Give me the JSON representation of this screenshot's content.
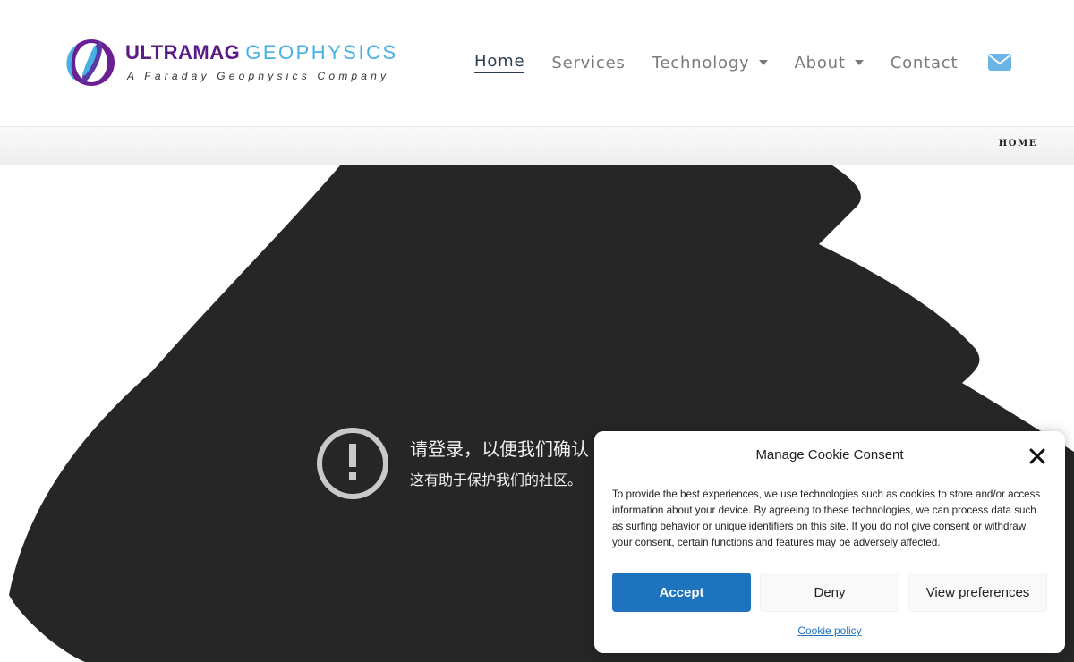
{
  "header": {
    "logo": {
      "name_part1": "ULTRAMAG",
      "name_part2": "GEOPHYSICS",
      "tagline": "A Faraday Geophysics Company",
      "colors": {
        "purple": "#5a1b86",
        "blue": "#47b1e3"
      }
    },
    "nav": [
      {
        "label": "Home",
        "active": true
      },
      {
        "label": "Services"
      },
      {
        "label": "Technology",
        "dropdown": true
      },
      {
        "label": "About",
        "dropdown": true
      },
      {
        "label": "Contact"
      }
    ],
    "mail_icon": "envelope-icon"
  },
  "breadcrumb": {
    "label": "HOME"
  },
  "captcha": {
    "title": "请登录，以便我们确认",
    "subtitle": "这有助于保护我们的社区。",
    "icon": "exclamation-circle-icon"
  },
  "cookie_dialog": {
    "title": "Manage Cookie Consent",
    "text": "To provide the best experiences, we use technologies such as cookies to store and/or access information about your device. By agreeing to these technologies, we can process data such as surfing behavior or unique identifiers on this site. If you do not give consent or withdraw your consent, certain functions and features may be adversely affected.",
    "accept_label": "Accept",
    "deny_label": "Deny",
    "preferences_label": "View preferences",
    "policy_link": "Cookie policy",
    "accent_color": "#1e73be"
  }
}
